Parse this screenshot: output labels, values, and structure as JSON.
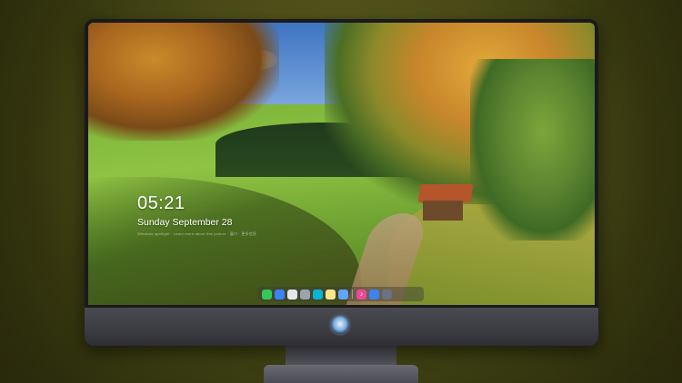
{
  "lock_screen": {
    "time": "05:21",
    "date": "Sunday September 28",
    "subline": "Windows spotlight · Learn more about this picture · 窗口 · 更多信息"
  },
  "dock": {
    "items": [
      {
        "name": "messages-icon",
        "glyph": "",
        "color": "#34c759"
      },
      {
        "name": "finder-icon",
        "glyph": "",
        "color": "#3b82f6"
      },
      {
        "name": "safari-icon",
        "glyph": "",
        "color": "#e5e7eb"
      },
      {
        "name": "photos-icon",
        "glyph": "",
        "color": "#9ca3af"
      },
      {
        "name": "files-icon",
        "glyph": "",
        "color": "#06b6d4"
      },
      {
        "name": "notes-icon",
        "glyph": "",
        "color": "#fde68a"
      },
      {
        "name": "preview-icon",
        "glyph": "",
        "color": "#60a5fa"
      },
      {
        "name": "music-icon",
        "glyph": "♪",
        "color": "#ec4899"
      },
      {
        "name": "app-store-icon",
        "glyph": "",
        "color": "#3b82f6"
      },
      {
        "name": "camera-icon",
        "glyph": "",
        "color": "#6b7280"
      }
    ]
  }
}
